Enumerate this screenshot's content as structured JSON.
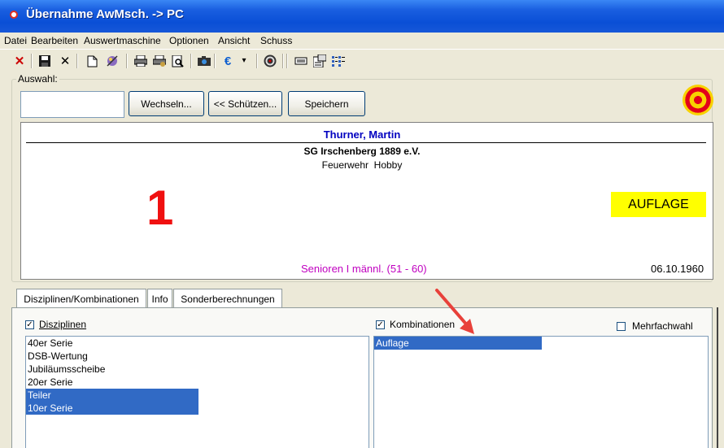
{
  "window": {
    "title": "Übernahme AwMsch. -> PC"
  },
  "menu": [
    "Datei",
    "Bearbeiten",
    "Auswertmaschine",
    "Optionen",
    "Ansicht",
    "Schuss"
  ],
  "toolbar": {
    "icons": [
      "close-x-icon",
      "save-icon",
      "delete-icon",
      "new-document-icon",
      "wizard-icon",
      "print-icon",
      "print-setup-icon",
      "print-preview-icon",
      "camera-icon",
      "euro-icon",
      "dropdown-arrow-icon",
      "target-icon",
      "print-list-icon",
      "properties-icon",
      "list-view-icon"
    ]
  },
  "auswahl": {
    "label": "Auswahl:",
    "input_value": "",
    "wechseln_label": "Wechseln...",
    "schuetzen_label": "<< Schützen...",
    "speichern_label": "Speichern"
  },
  "shooter": {
    "name": "Thurner, Martin",
    "club": "SG Irschenberg 1889 e.V.",
    "subline": "Feuerwehr  Hobby",
    "number": "1",
    "badge": "AUFLAGE",
    "klasse": "Senioren I männl. (51 - 60)",
    "geburtsdatum": "06.10.1960"
  },
  "tabs": [
    "Disziplinen/Kombinationen",
    "Info",
    "Sonderberechnungen"
  ],
  "disziplinen": {
    "label": "Disziplinen",
    "checked": true,
    "items": [
      {
        "label": "40er Serie",
        "selected": false
      },
      {
        "label": "DSB-Wertung",
        "selected": false
      },
      {
        "label": "Jubiläumsscheibe",
        "selected": false
      },
      {
        "label": "20er Serie",
        "selected": false
      },
      {
        "label": "Teiler",
        "selected": true
      },
      {
        "label": "10er Serie",
        "selected": true
      }
    ]
  },
  "kombinationen": {
    "label": "Kombinationen",
    "checked": true,
    "items": [
      {
        "label": "Auflage",
        "selected": true
      }
    ]
  },
  "mehrfachwahl": {
    "label": "Mehrfachwahl",
    "checked": false
  },
  "colors": {
    "accent": "#316ac5",
    "name": "#0000c0",
    "number": "#f01010",
    "badge": "#ffff00",
    "klasse": "#c000c0",
    "arrow": "#e8413a"
  }
}
